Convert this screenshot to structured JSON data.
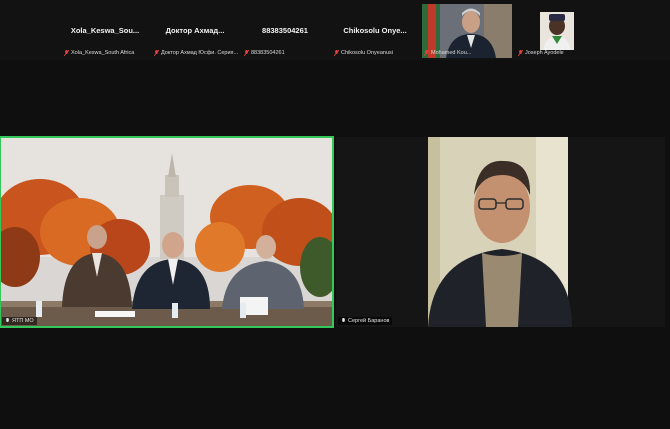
{
  "participants_strip": [
    {
      "name": "Xola_Keswa_Sou...",
      "label": "Xola_Keswa_South Africa",
      "muted": true
    },
    {
      "name": "Доктор Ахмад...",
      "label": "Доктор Ахмад Юсфи. Серия...",
      "muted": true
    },
    {
      "name": "88383504261",
      "label": "88383504261",
      "muted": true
    },
    {
      "name": "Chikosolu Onye...",
      "label": "Chikosolu Onyeanusi",
      "muted": true
    },
    {
      "name": "",
      "label": "Mohamed Kou...",
      "muted": true,
      "video": true
    },
    {
      "name": "",
      "label": "Joseph Ayodele",
      "muted": true,
      "video": true
    }
  ],
  "main_videos": [
    {
      "label": "ЯТП МО",
      "active_speaker": true
    },
    {
      "label": "Сергей Баранов",
      "active_speaker": false
    }
  ],
  "colors": {
    "background": "#0f0f0f",
    "speaker_border": "#34c759",
    "muted_icon": "#e0443e"
  }
}
